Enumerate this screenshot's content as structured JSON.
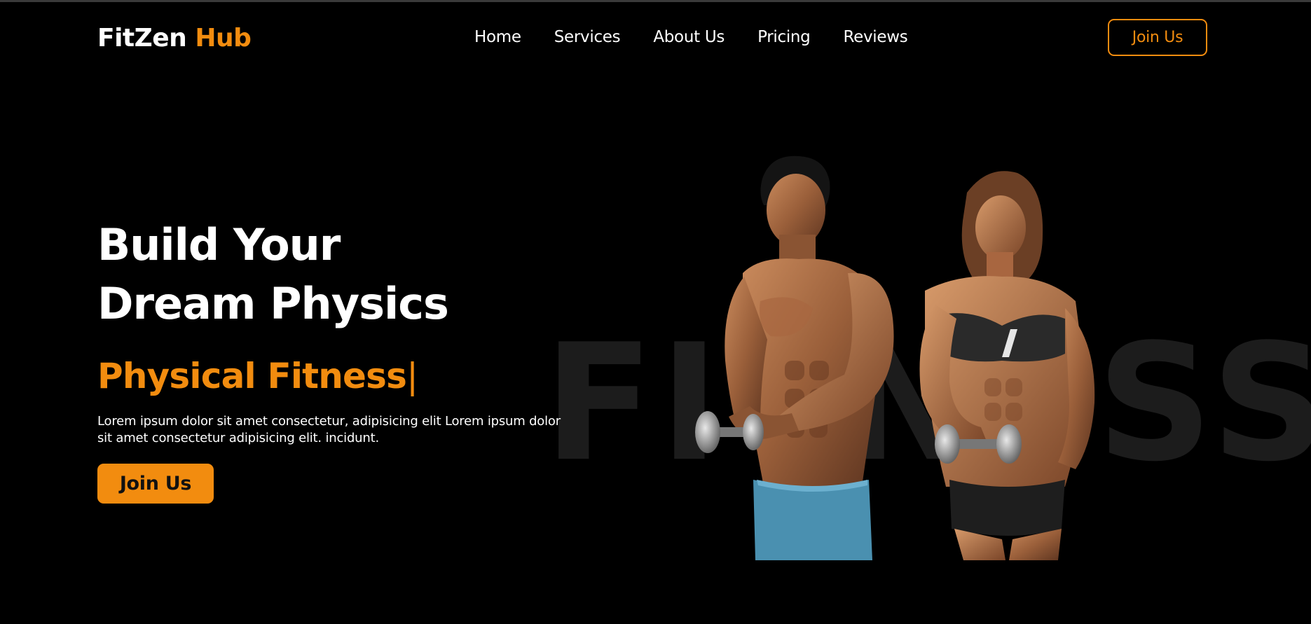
{
  "brand": {
    "name_part1": "FitZen",
    "name_part2": "Hub",
    "accent_color": "#f28c0f"
  },
  "nav": {
    "items": [
      {
        "label": "Home"
      },
      {
        "label": "Services"
      },
      {
        "label": "About Us"
      },
      {
        "label": "Pricing"
      },
      {
        "label": "Reviews"
      }
    ],
    "cta_label": "Join Us"
  },
  "hero": {
    "title_line1": "Build Your",
    "title_line2": "Dream Physics",
    "subtitle": "Physical Fitness",
    "caret": "|",
    "description": "Lorem ipsum dolor sit amet consectetur, adipisicing elit Lorem ipsum dolor sit amet consectetur adipisicing elit. incidunt.",
    "cta_label": "Join Us",
    "background_word": "FITNESS"
  },
  "colors": {
    "background": "#000000",
    "text": "#ffffff",
    "accent": "#f28c0f"
  }
}
